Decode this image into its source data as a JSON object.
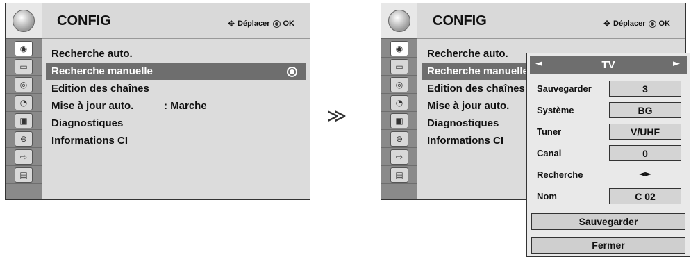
{
  "left_panel": {
    "title": "CONFIG",
    "hint_move": "Déplacer",
    "hint_ok": "OK",
    "menu": [
      {
        "label": "Recherche auto.",
        "value": ""
      },
      {
        "label": "Recherche manuelle",
        "value": ""
      },
      {
        "label": "Edition des chaînes",
        "value": ""
      },
      {
        "label": "Mise à jour auto.",
        "value": ": Marche"
      },
      {
        "label": "Diagnostiques",
        "value": ""
      },
      {
        "label": "Informations CI",
        "value": ""
      }
    ]
  },
  "arrow": "≫",
  "right_panel": {
    "title": "CONFIG",
    "hint_move": "Déplacer",
    "hint_ok": "OK",
    "menu": [
      {
        "label": "Recherche auto."
      },
      {
        "label": "Recherche manuelle"
      },
      {
        "label": "Edition des chaînes"
      },
      {
        "label": "Mise à jour auto."
      },
      {
        "label": "Diagnostiques"
      },
      {
        "label": "Informations CI"
      }
    ]
  },
  "popup": {
    "header_left": "◄",
    "header_title": "TV",
    "header_right": "►",
    "rows": [
      {
        "label": "Sauvegarder",
        "value": "3"
      },
      {
        "label": "Système",
        "value": "BG"
      },
      {
        "label": "Tuner",
        "value": "V/UHF"
      },
      {
        "label": "Canal",
        "value": "0"
      },
      {
        "label": "Recherche",
        "value": "◄►"
      },
      {
        "label": "Nom",
        "value": "C  02"
      }
    ],
    "save_button": "Sauvegarder",
    "close_button": "Fermer"
  },
  "sidebar_icons": [
    "antenna-icon",
    "picture-icon",
    "audio-icon",
    "time-icon",
    "option-icon",
    "lock-icon",
    "input-icon",
    "usb-icon"
  ]
}
